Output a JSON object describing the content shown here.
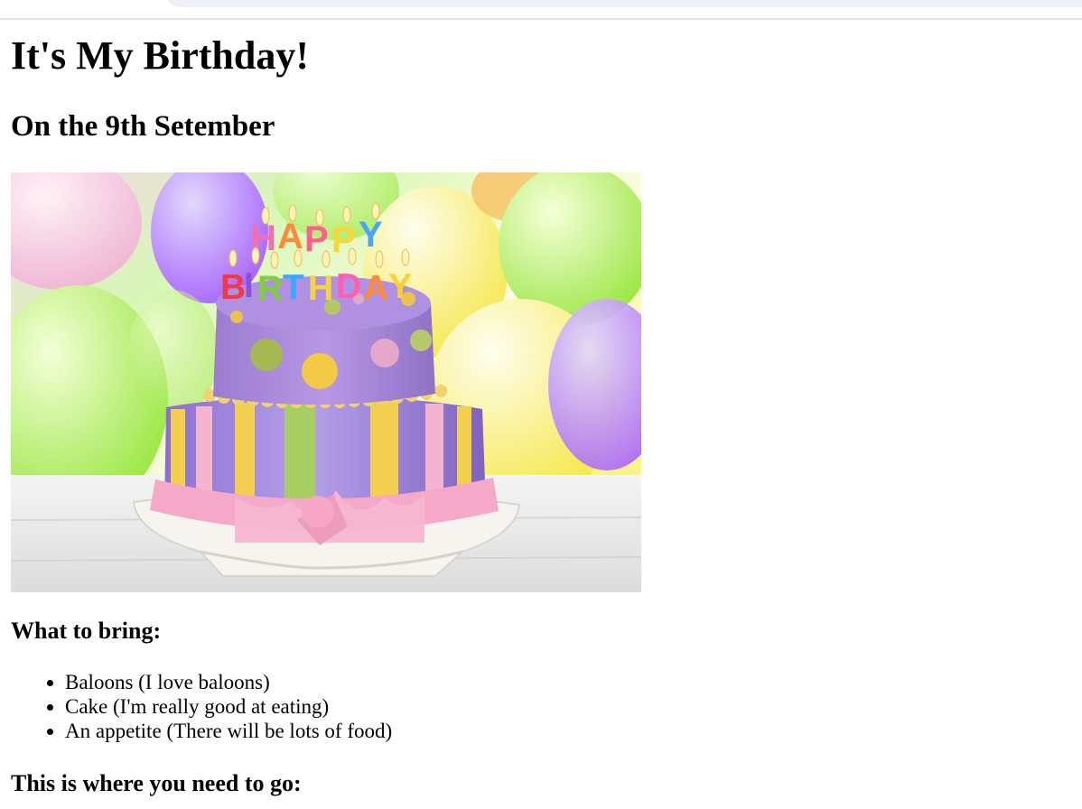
{
  "page": {
    "title": "It's My Birthday!",
    "subtitle": "On the 9th Setember"
  },
  "hero_image": {
    "icon": "birthday-cake-image",
    "candle_letters_top": [
      "H",
      "A",
      "P",
      "P",
      "Y"
    ],
    "candle_letters_bottom": [
      "B",
      "I",
      "R",
      "T",
      "H",
      "D",
      "A",
      "Y"
    ],
    "colors": {
      "cake_top": "#a98ad6",
      "cake_bottom": "#9f84d4",
      "ribbon": "#f4a9c8",
      "stripe_yellow": "#f2cf4f",
      "stripe_green": "#a7cd63",
      "background_yellow": "#f8f06a",
      "background_green": "#b8ec62"
    }
  },
  "bring": {
    "heading": "What to bring:",
    "items": [
      "Baloons (I love baloons)",
      "Cake (I'm really good at eating)",
      "An appetite (There will be lots of food)"
    ]
  },
  "location": {
    "heading": "This is where you need to go:"
  }
}
